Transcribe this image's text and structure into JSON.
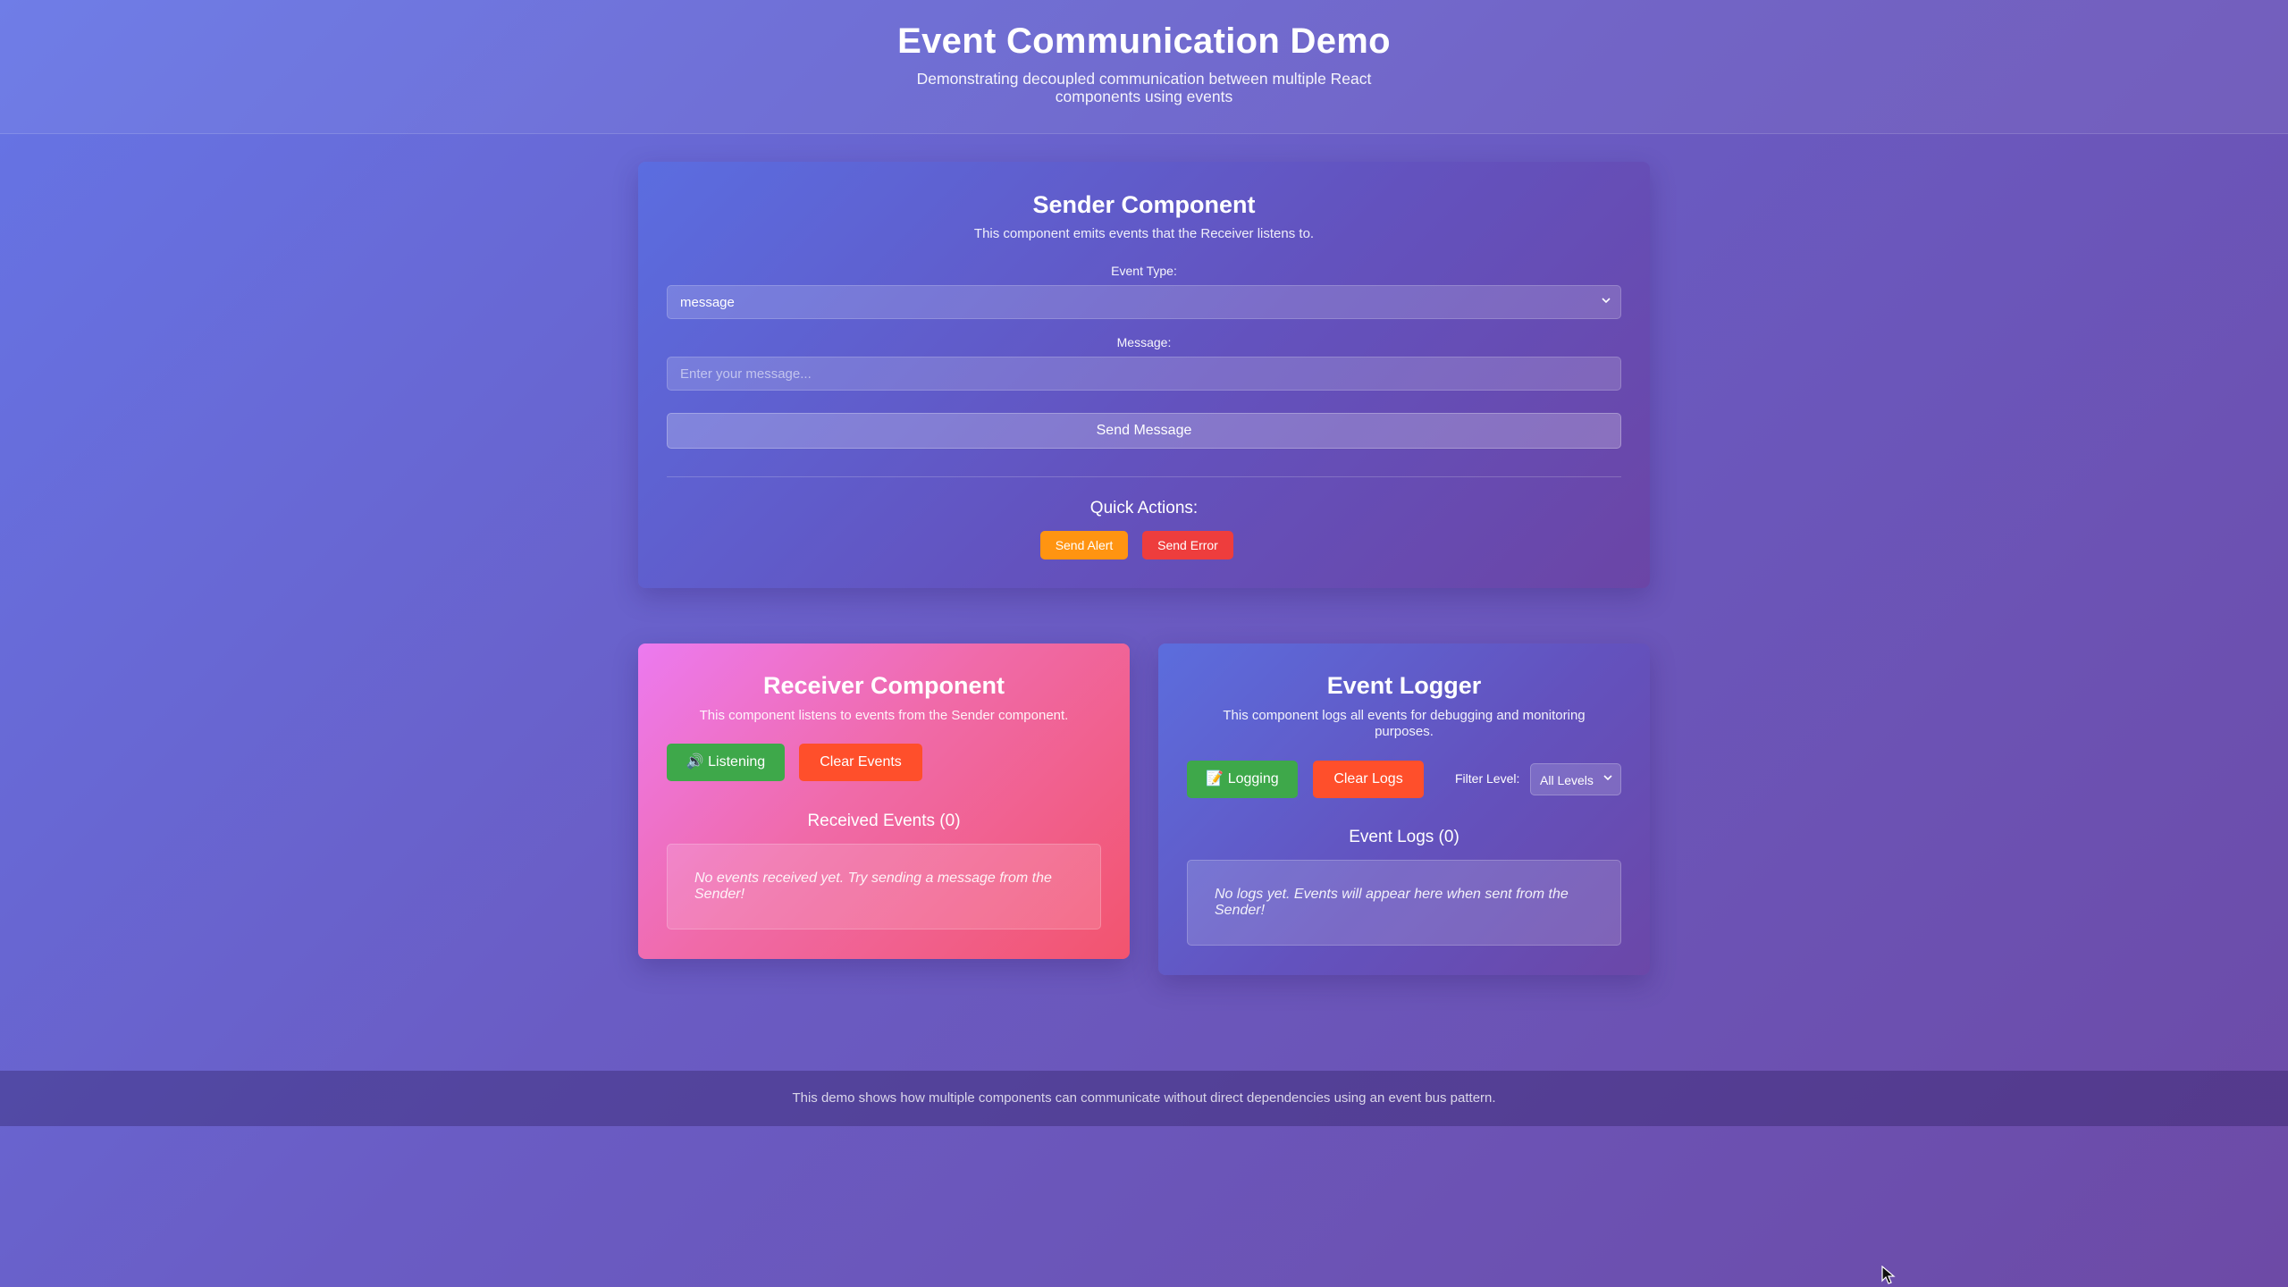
{
  "header": {
    "title": "Event Communication Demo",
    "subtitle": "Demonstrating decoupled communication between multiple React components using events"
  },
  "sender": {
    "title": "Sender Component",
    "description": "This component emits events that the Receiver listens to.",
    "event_type_label": "Event Type:",
    "event_type_value": "message",
    "message_label": "Message:",
    "message_placeholder": "Enter your message...",
    "send_button": "Send Message",
    "quick_actions_label": "Quick Actions:",
    "send_alert_button": "Send Alert",
    "send_error_button": "Send Error"
  },
  "receiver": {
    "title": "Receiver Component",
    "description": "This component listens to events from the Sender component.",
    "listening_icon": "🔊",
    "listening_button": "Listening",
    "clear_button": "Clear Events",
    "events_heading": "Received Events (0)",
    "empty_text": "No events received yet. Try sending a message from the Sender!"
  },
  "logger": {
    "title": "Event Logger",
    "description": "This component logs all events for debugging and monitoring purposes.",
    "logging_icon": "📝",
    "logging_button": "Logging",
    "clear_button": "Clear Logs",
    "filter_label": "Filter Level:",
    "filter_value": "All Levels",
    "logs_heading": "Event Logs (0)",
    "empty_text": "No logs yet. Events will appear here when sent from the Sender!"
  },
  "footer": {
    "text": "This demo shows how multiple components can communicate without direct dependencies using an event bus pattern."
  },
  "colors": {
    "background_start": "#6675e6",
    "background_end": "#6d4aa6",
    "alert_orange": "#ff9411",
    "error_red": "#ee3d3d",
    "active_green": "#3ea84a",
    "clear_orange_red": "#ff4f2b",
    "receiver_pink": "#f06aa8"
  }
}
